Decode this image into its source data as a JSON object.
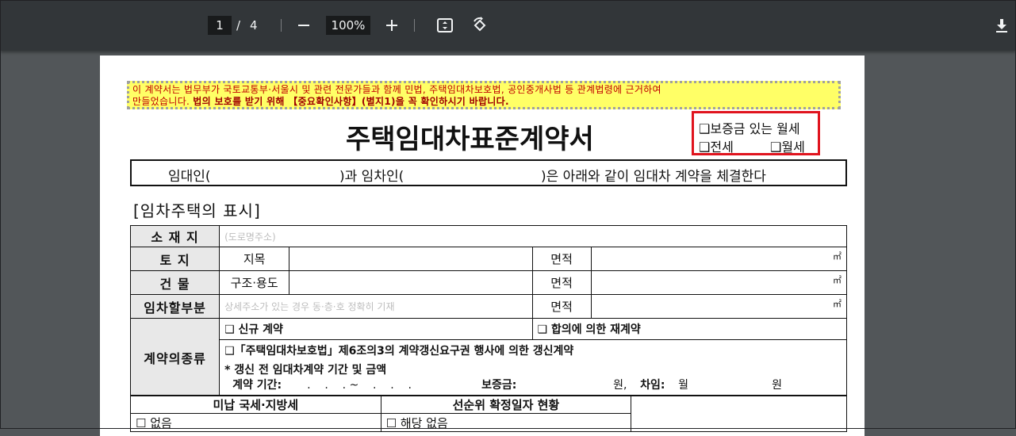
{
  "viewer": {
    "current_page": "1",
    "page_sep": "/",
    "total_pages": "4",
    "zoom": "100%"
  },
  "document": {
    "notice_line1": "이 계약서는 법무부가 국토교통부·서울시 및 관련 전문가들과 함께 민법, 주택임대차보호법, 공인중개사법 등 관계법령에 근거하여",
    "notice_line2_plain": "만들었습니다. ",
    "notice_line2_bold": "법의 보호를 받기 위해 【중요확인사항】(별지1)을 꼭 확인하시기 바랍니다.",
    "title": "주택임대차표준계약서",
    "type_option1": "❑보증금 있는 월세",
    "type_option2": "❑전세",
    "type_option3": "❑월세",
    "intro_part1": "임대인(",
    "intro_part2": ")과 임차인(",
    "intro_part3": ")은 아래와 같이 임대차 계약을 체결한다",
    "section_title": "[임차주택의 표시]",
    "rows": {
      "location_label": "소 재 지",
      "location_placeholder": "(도로명주소)",
      "land_label": "토   지",
      "land_sub": "지목",
      "area_label": "면적",
      "unit": "㎡",
      "building_label": "건   물",
      "building_sub": "구조·용도",
      "rental_part_label": "임차할부분",
      "rental_part_placeholder": "상세주소가 있는 경우 동·층·호 정확히 기재",
      "contract_type_label": "계약의종류",
      "new_contract": "❑ 신규 계약",
      "renewal_agreement": "❑ 합의에 의한 재계약",
      "renewal_claim": "❑「주택임대차보호법」제6조의3의 계약갱신요구권 행사에 의한 갱신계약",
      "renewal_note": "* 갱신 전 임대차계약 기간 및 금액",
      "period_label": "계약 기간:",
      "period_dots": ".    .    . ~    .    .    .",
      "deposit_label": "보증금:",
      "won1": "원,",
      "rent_label": "차임:",
      "monthly": "월",
      "won2": "원"
    },
    "bottom": {
      "unpaid_tax_header": "미납 국세·지방세",
      "priority_header": "선순위 확정일자 현황",
      "unpaid_none": "☐ 없음",
      "priority_none": "☐ 해당 없음"
    }
  }
}
